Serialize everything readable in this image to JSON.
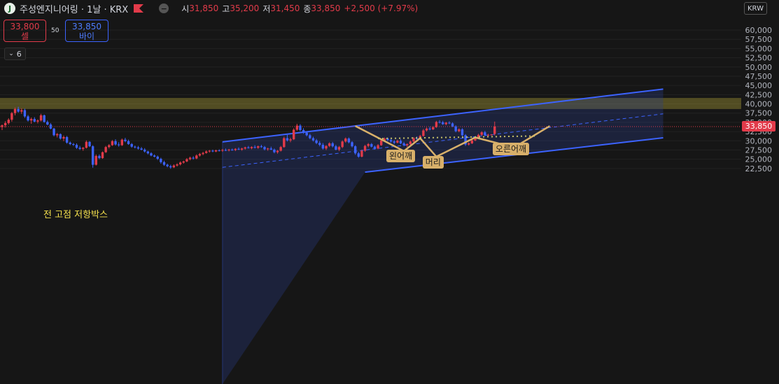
{
  "header": {
    "logo_letter": "J",
    "symbol_title": "주성엔지니어링 · 1날 · KRX",
    "ohlc": [
      {
        "key": "시",
        "value": "31,850"
      },
      {
        "key": "고",
        "value": "35,200"
      },
      {
        "key": "저",
        "value": "31,450"
      },
      {
        "key": "종",
        "value": "33,850"
      }
    ],
    "change": "+2,500 (+7.97%)",
    "currency": "KRW"
  },
  "trade": {
    "sell_price": "33,800",
    "sell_label": "셀",
    "spread": "50",
    "buy_price": "33,850",
    "buy_label": "바이",
    "collapse_count": "6"
  },
  "chart_data": {
    "type": "candlestick",
    "y_axis_ticks": [
      "60,000",
      "57,500",
      "55,000",
      "52,500",
      "50,000",
      "47,500",
      "45,000",
      "42,500",
      "40,000",
      "37,500",
      "35,000",
      "32,500",
      "30,000",
      "27,500",
      "25,000",
      "22,500"
    ],
    "ylim": [
      21500,
      61500
    ],
    "last_price": "33,850",
    "last_price_value": 33850,
    "colors": {
      "up": "#e23b4a",
      "down": "#3c63ff",
      "channel": "#3c63ff",
      "pattern": "#d8b06a",
      "neckline": "#c9c36a",
      "zone": "#f4e04d"
    },
    "resistance_zone": {
      "label": "전 고점 저항박스",
      "from": 38600,
      "to": 41600
    },
    "channel": {
      "upper": [
        {
          "bar": 68,
          "price": 29700
        },
        {
          "bar": 204,
          "price": 44000
        }
      ],
      "middle": [
        {
          "bar": 68,
          "price": 22800
        },
        {
          "bar": 204,
          "price": 37300
        }
      ],
      "lower": [
        {
          "bar": 112,
          "price": 21500
        },
        {
          "bar": 204,
          "price": 30800
        }
      ]
    },
    "pattern": {
      "points": [
        {
          "bar": 109,
          "price": 34000
        },
        {
          "bar": 124,
          "price": 27200
        },
        {
          "bar": 129,
          "price": 30700
        },
        {
          "bar": 134,
          "price": 25700
        },
        {
          "bar": 146,
          "price": 30900
        },
        {
          "bar": 158,
          "price": 28200
        },
        {
          "bar": 169,
          "price": 34000
        }
      ],
      "neckline": [
        {
          "bar": 116,
          "price": 30600
        },
        {
          "bar": 165,
          "price": 31300
        }
      ]
    },
    "annotations": [
      {
        "text": "왼어깨",
        "bar": 123,
        "price": 25800
      },
      {
        "text": "머리",
        "bar": 133,
        "price": 24200
      },
      {
        "text": "오른어깨",
        "bar": 157,
        "price": 27700
      }
    ],
    "candles": [
      [
        33700,
        34400,
        32900,
        34200
      ],
      [
        34200,
        35300,
        33600,
        34800
      ],
      [
        34800,
        36100,
        34400,
        35700
      ],
      [
        35700,
        37800,
        35200,
        37500
      ],
      [
        37500,
        39000,
        36900,
        38600
      ],
      [
        38600,
        39200,
        37600,
        37900
      ],
      [
        37900,
        38800,
        37300,
        38300
      ],
      [
        38300,
        38700,
        36200,
        36600
      ],
      [
        36600,
        37000,
        35200,
        35500
      ],
      [
        35500,
        36300,
        34600,
        35900
      ],
      [
        35900,
        36400,
        35000,
        35200
      ],
      [
        35200,
        35800,
        34700,
        35500
      ],
      [
        35500,
        37300,
        35200,
        36900
      ],
      [
        36900,
        37100,
        34900,
        35100
      ],
      [
        35100,
        35500,
        34200,
        34400
      ],
      [
        34400,
        34800,
        33100,
        33300
      ],
      [
        33300,
        33500,
        31200,
        31500
      ],
      [
        31500,
        32100,
        30900,
        31800
      ],
      [
        31800,
        32000,
        30300,
        30600
      ],
      [
        30600,
        31400,
        29900,
        31000
      ],
      [
        31000,
        31300,
        29200,
        29500
      ],
      [
        29500,
        29800,
        28800,
        29100
      ],
      [
        29100,
        29400,
        28600,
        28900
      ],
      [
        28900,
        29300,
        27800,
        28100
      ],
      [
        28100,
        28600,
        27500,
        27800
      ],
      [
        27800,
        28300,
        27300,
        28100
      ],
      [
        28100,
        30100,
        27900,
        29700
      ],
      [
        29700,
        29900,
        28300,
        28500
      ],
      [
        28500,
        28800,
        22700,
        23500
      ],
      [
        23500,
        26300,
        23300,
        25900
      ],
      [
        25900,
        26300,
        25000,
        25300
      ],
      [
        25300,
        27100,
        25100,
        26900
      ],
      [
        26900,
        28600,
        26700,
        28300
      ],
      [
        28300,
        29100,
        27900,
        28800
      ],
      [
        28800,
        30200,
        28600,
        29900
      ],
      [
        29900,
        30400,
        28700,
        29000
      ],
      [
        29000,
        29600,
        28400,
        28800
      ],
      [
        28800,
        30600,
        28600,
        30300
      ],
      [
        30300,
        30800,
        29600,
        29900
      ],
      [
        29900,
        30300,
        28900,
        29100
      ],
      [
        29100,
        29400,
        28100,
        28400
      ],
      [
        28400,
        28700,
        27900,
        28200
      ],
      [
        28200,
        28600,
        27600,
        27900
      ],
      [
        27900,
        28300,
        27400,
        27600
      ],
      [
        27600,
        28000,
        26800,
        27100
      ],
      [
        27100,
        27300,
        26300,
        26600
      ],
      [
        26600,
        26900,
        25800,
        26000
      ],
      [
        26000,
        26300,
        25500,
        25700
      ],
      [
        25700,
        26000,
        24800,
        25100
      ],
      [
        25100,
        25400,
        23800,
        24200
      ],
      [
        24200,
        24600,
        23200,
        23500
      ],
      [
        23500,
        23800,
        22800,
        23100
      ],
      [
        23100,
        23500,
        22400,
        22800
      ],
      [
        22800,
        23600,
        22600,
        23300
      ],
      [
        23300,
        23900,
        23000,
        23600
      ],
      [
        23600,
        24400,
        23300,
        24100
      ],
      [
        24100,
        24600,
        23800,
        24400
      ],
      [
        24400,
        25300,
        24200,
        25000
      ],
      [
        25000,
        25700,
        24700,
        25400
      ],
      [
        25400,
        25800,
        24900,
        25200
      ],
      [
        25200,
        26300,
        25000,
        26000
      ],
      [
        26000,
        26700,
        25700,
        26400
      ],
      [
        26400,
        27000,
        26100,
        26700
      ],
      [
        26700,
        27400,
        26500,
        27100
      ],
      [
        27100,
        27500,
        26800,
        27300
      ],
      [
        27300,
        27600,
        26900,
        27100
      ],
      [
        27100,
        27600,
        26900,
        27400
      ],
      [
        27400,
        27700,
        27100,
        27300
      ],
      [
        27300,
        27800,
        27000,
        27500
      ],
      [
        27500,
        27900,
        27200,
        27400
      ],
      [
        27400,
        27800,
        27100,
        27600
      ],
      [
        27600,
        27900,
        27300,
        27500
      ],
      [
        27500,
        28000,
        27200,
        27800
      ],
      [
        27800,
        28200,
        27500,
        27600
      ],
      [
        27600,
        28100,
        27300,
        27900
      ],
      [
        27900,
        28400,
        27600,
        28200
      ],
      [
        28200,
        28600,
        27900,
        28000
      ],
      [
        28000,
        28500,
        27700,
        28300
      ],
      [
        28300,
        28800,
        27900,
        28100
      ],
      [
        28100,
        28700,
        27800,
        28500
      ],
      [
        28500,
        28900,
        28100,
        28300
      ],
      [
        28300,
        28600,
        27400,
        27700
      ],
      [
        27700,
        28100,
        27300,
        27900
      ],
      [
        27900,
        28400,
        27500,
        27600
      ],
      [
        27600,
        27900,
        26600,
        26900
      ],
      [
        26900,
        27500,
        26500,
        27300
      ],
      [
        27300,
        28600,
        27100,
        28300
      ],
      [
        28300,
        31100,
        28100,
        30700
      ],
      [
        30700,
        31600,
        29800,
        30100
      ],
      [
        30100,
        30800,
        29600,
        30400
      ],
      [
        30400,
        33400,
        30200,
        33000
      ],
      [
        33000,
        34600,
        32700,
        34100
      ],
      [
        34100,
        34500,
        32600,
        32900
      ],
      [
        32900,
        33400,
        31900,
        32200
      ],
      [
        32200,
        32600,
        31200,
        31500
      ],
      [
        31500,
        31900,
        30400,
        30700
      ],
      [
        30700,
        31100,
        29800,
        30100
      ],
      [
        30100,
        30500,
        29100,
        29400
      ],
      [
        29400,
        29900,
        28500,
        28900
      ],
      [
        28900,
        29400,
        27600,
        27900
      ],
      [
        27900,
        28800,
        27500,
        28600
      ],
      [
        28600,
        29600,
        28300,
        29300
      ],
      [
        29300,
        29700,
        28200,
        28500
      ],
      [
        28500,
        28900,
        27400,
        27600
      ],
      [
        27600,
        28600,
        27200,
        28300
      ],
      [
        28300,
        30100,
        28000,
        29800
      ],
      [
        29800,
        30900,
        29500,
        30600
      ],
      [
        30600,
        30900,
        29300,
        29600
      ],
      [
        29600,
        29900,
        28200,
        28500
      ],
      [
        28500,
        28800,
        26200,
        26600
      ],
      [
        26600,
        27000,
        25400,
        25700
      ],
      [
        25700,
        27600,
        25500,
        27300
      ],
      [
        27300,
        28900,
        27000,
        28600
      ],
      [
        28600,
        29400,
        28200,
        29100
      ],
      [
        29100,
        29400,
        28200,
        28400
      ],
      [
        28400,
        28700,
        27600,
        27900
      ],
      [
        27900,
        29100,
        27700,
        28800
      ],
      [
        28800,
        30400,
        28600,
        30100
      ],
      [
        30100,
        30900,
        29800,
        30600
      ],
      [
        30600,
        30900,
        29900,
        30200
      ],
      [
        30200,
        30600,
        29500,
        29800
      ],
      [
        29800,
        30200,
        29100,
        29500
      ],
      [
        29500,
        30300,
        29300,
        30000
      ],
      [
        30000,
        30400,
        29100,
        29300
      ],
      [
        29300,
        29700,
        28500,
        28800
      ],
      [
        28800,
        29300,
        28300,
        29100
      ],
      [
        29100,
        30100,
        28900,
        29800
      ],
      [
        29800,
        31000,
        29600,
        30700
      ],
      [
        30700,
        31200,
        30200,
        30500
      ],
      [
        30500,
        31600,
        30300,
        31300
      ],
      [
        31300,
        33200,
        31100,
        32800
      ],
      [
        32800,
        33600,
        32500,
        33300
      ],
      [
        33300,
        33800,
        32800,
        33100
      ],
      [
        33100,
        34000,
        32900,
        33700
      ],
      [
        33700,
        35400,
        33500,
        35100
      ],
      [
        35100,
        35600,
        34700,
        35000
      ],
      [
        35000,
        35400,
        34300,
        34500
      ],
      [
        34500,
        35100,
        34200,
        34900
      ],
      [
        34900,
        35300,
        34500,
        34700
      ],
      [
        34700,
        35000,
        33700,
        33900
      ],
      [
        33900,
        34200,
        32300,
        32600
      ],
      [
        32600,
        33400,
        32300,
        33100
      ],
      [
        33100,
        33400,
        31200,
        31500
      ],
      [
        31500,
        31800,
        28600,
        29000
      ],
      [
        29000,
        29600,
        28700,
        29300
      ],
      [
        29300,
        30400,
        29100,
        30100
      ],
      [
        30100,
        31000,
        29900,
        30700
      ],
      [
        30700,
        31900,
        30500,
        31600
      ],
      [
        31600,
        32600,
        31300,
        32300
      ],
      [
        32300,
        32700,
        31200,
        31500
      ],
      [
        31500,
        31900,
        31200,
        31600
      ],
      [
        31600,
        31800,
        31400,
        31700
      ],
      [
        31850,
        35200,
        31450,
        33850
      ]
    ]
  }
}
